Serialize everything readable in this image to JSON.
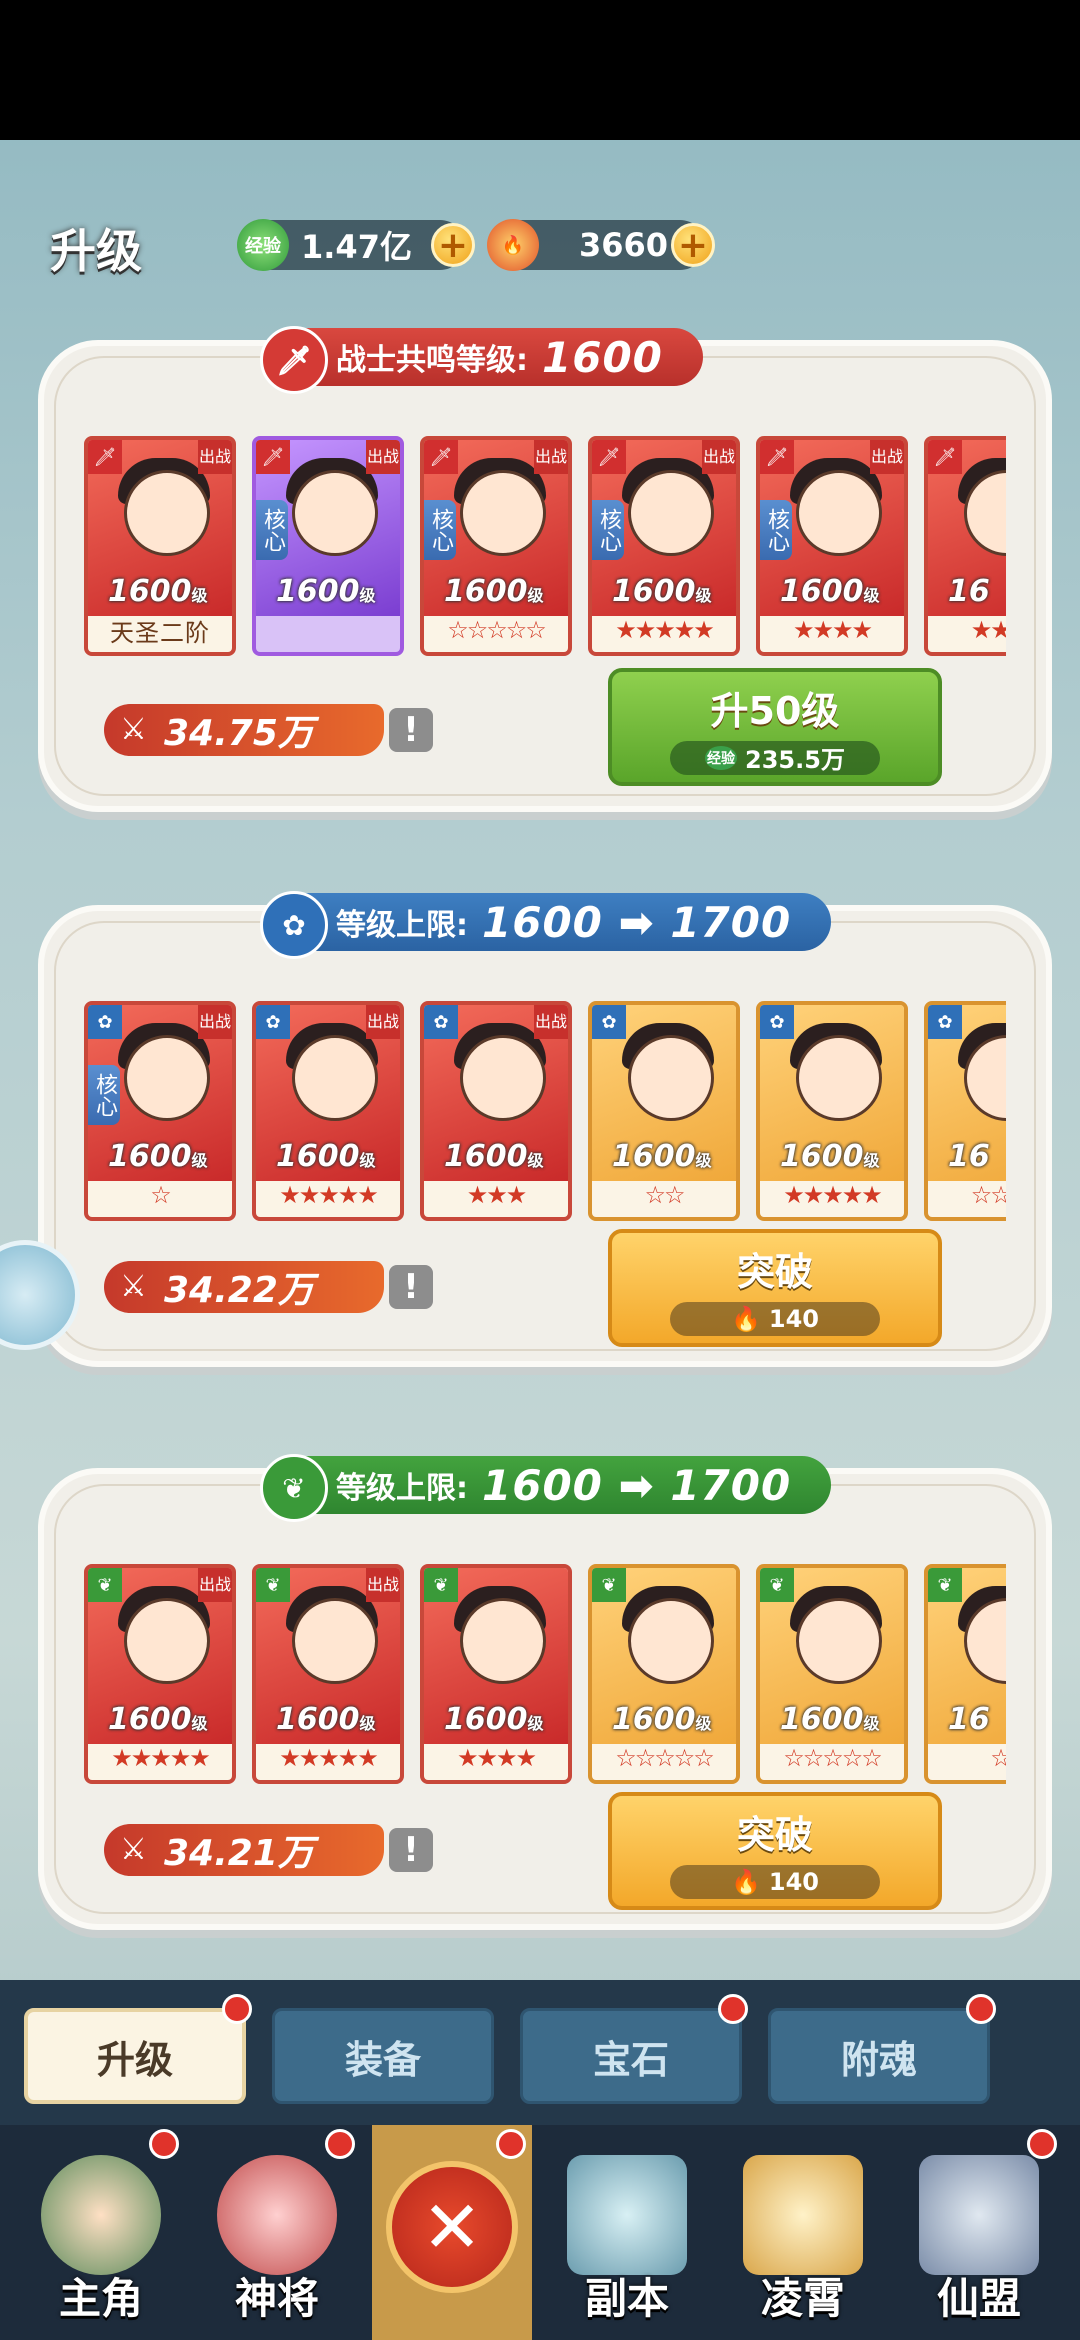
{
  "header": {
    "title": "升级",
    "exp": {
      "icon": "经验",
      "value": "1.47亿"
    },
    "gem": {
      "value": "3660"
    }
  },
  "panels": [
    {
      "banner_label": "战士共鸣等级:",
      "banner_value": "1600",
      "cards": [
        {
          "level": "1600",
          "unit": "级",
          "footer": "天圣二阶",
          "stars": "",
          "core": "",
          "out": "出战",
          "theme": "red"
        },
        {
          "level": "1600",
          "unit": "级",
          "footer": "",
          "stars": "",
          "core": "核心",
          "out": "出战",
          "theme": "purple"
        },
        {
          "level": "1600",
          "unit": "级",
          "footer": "",
          "stars": "☆☆☆☆☆",
          "core": "核心",
          "out": "出战",
          "theme": "red"
        },
        {
          "level": "1600",
          "unit": "级",
          "footer": "",
          "stars": "★★★★★",
          "core": "核心",
          "out": "出战",
          "theme": "red"
        },
        {
          "level": "1600",
          "unit": "级",
          "footer": "",
          "stars": "★★★★",
          "core": "核心",
          "out": "出战",
          "theme": "red"
        },
        {
          "level": "16",
          "unit": "",
          "footer": "",
          "stars": "★★★",
          "core": "",
          "out": "",
          "theme": "red"
        }
      ],
      "power": "34.75万",
      "action": {
        "label": "升50级",
        "cost_icon": "经验",
        "cost": "235.5万"
      }
    },
    {
      "banner_label": "等级上限:",
      "banner_value": "1600 ➡ 1700",
      "cards": [
        {
          "level": "1600",
          "unit": "级",
          "footer": "",
          "stars": "☆",
          "core": "核心",
          "out": "出战",
          "theme": "red"
        },
        {
          "level": "1600",
          "unit": "级",
          "footer": "",
          "stars": "★★★★★",
          "core": "",
          "out": "出战",
          "theme": "red"
        },
        {
          "level": "1600",
          "unit": "级",
          "footer": "",
          "stars": "★★★",
          "core": "",
          "out": "出战",
          "theme": "red"
        },
        {
          "level": "1600",
          "unit": "级",
          "footer": "",
          "stars": "☆☆",
          "core": "",
          "out": "",
          "theme": "orange"
        },
        {
          "level": "1600",
          "unit": "级",
          "footer": "",
          "stars": "★★★★★",
          "core": "",
          "out": "",
          "theme": "orange"
        },
        {
          "level": "16",
          "unit": "",
          "footer": "",
          "stars": "☆☆☆",
          "core": "",
          "out": "",
          "theme": "orange"
        }
      ],
      "power": "34.22万",
      "action": {
        "label": "突破",
        "cost_icon": "🔥",
        "cost": "140"
      }
    },
    {
      "banner_label": "等级上限:",
      "banner_value": "1600 ➡ 1700",
      "cards": [
        {
          "level": "1600",
          "unit": "级",
          "footer": "",
          "stars": "★★★★★",
          "core": "",
          "out": "出战",
          "theme": "red"
        },
        {
          "level": "1600",
          "unit": "级",
          "footer": "",
          "stars": "★★★★★",
          "core": "",
          "out": "出战",
          "theme": "red"
        },
        {
          "level": "1600",
          "unit": "级",
          "footer": "",
          "stars": "★★★★",
          "core": "",
          "out": "",
          "theme": "red"
        },
        {
          "level": "1600",
          "unit": "级",
          "footer": "",
          "stars": "☆☆☆☆☆",
          "core": "",
          "out": "",
          "theme": "orange"
        },
        {
          "level": "1600",
          "unit": "级",
          "footer": "",
          "stars": "☆☆☆☆☆",
          "core": "",
          "out": "",
          "theme": "orange"
        },
        {
          "level": "16",
          "unit": "",
          "footer": "",
          "stars": "☆",
          "core": "",
          "out": "",
          "theme": "orange"
        }
      ],
      "power": "34.21万",
      "action": {
        "label": "突破",
        "cost_icon": "🔥",
        "cost": "140"
      }
    }
  ],
  "tabs": [
    "升级",
    "装备",
    "宝石",
    "附魂"
  ],
  "nav": [
    "主角",
    "神将",
    "副本",
    "凌霄",
    "仙盟"
  ],
  "close_glyph": "✕",
  "warn_glyph": "!"
}
